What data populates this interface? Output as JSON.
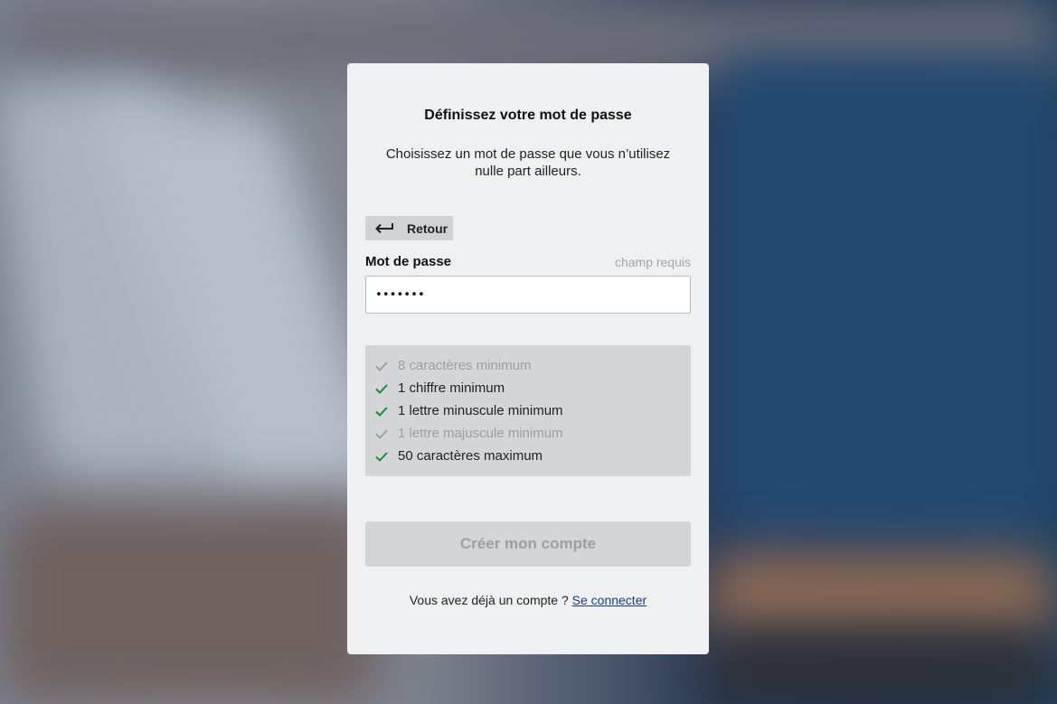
{
  "colors": {
    "card_background": "#eff0f2",
    "check_ok": "#1a8a34",
    "check_pending": "#9c9ea2",
    "link": "#1d3b8c",
    "button_disabled": "#d4d5d7"
  },
  "title": "Définissez votre mot de passe",
  "subtitle": "Choisissez un mot de passe que vous n’utilisez nulle part ailleurs.",
  "back_button": {
    "icon": "arrow-return-left-icon",
    "label": "Retour"
  },
  "password_field": {
    "label": "Mot de passe",
    "hint": "champ requis",
    "value": "•••••••"
  },
  "requirements": [
    {
      "text": "8 caractères minimum",
      "met": false
    },
    {
      "text": "1 chiffre minimum",
      "met": true
    },
    {
      "text": "1 lettre minuscule minimum",
      "met": true
    },
    {
      "text": "1 lettre majuscule minimum",
      "met": false
    },
    {
      "text": "50 caractères maximum",
      "met": true
    }
  ],
  "submit_button": {
    "label": "Créer mon compte",
    "enabled": false
  },
  "login_prompt": {
    "text": "Vous avez déjà un compte ?",
    "link_label": "Se connecter"
  }
}
